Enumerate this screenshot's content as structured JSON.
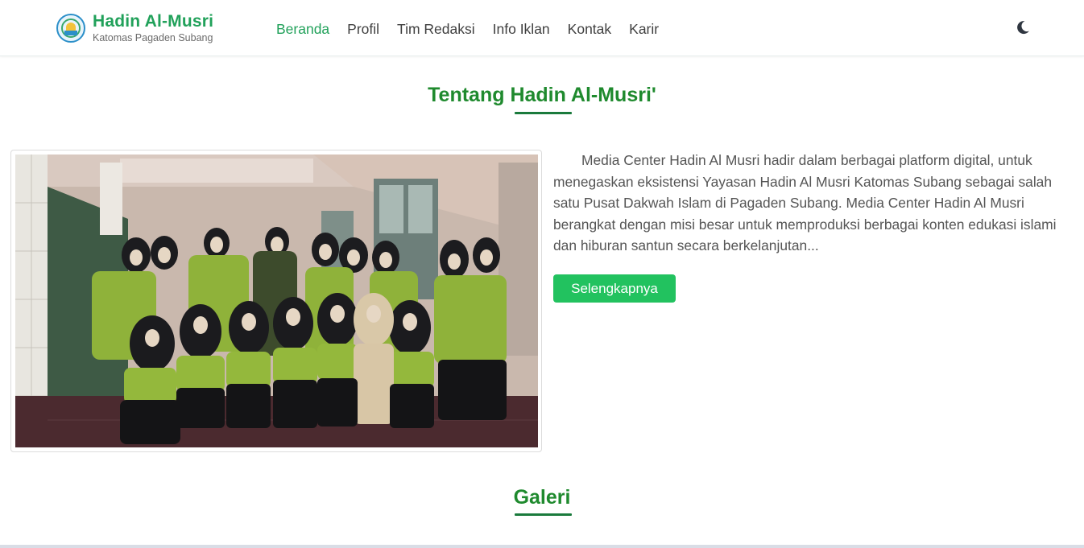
{
  "header": {
    "brand_title": "Hadin Al-Musri",
    "brand_subtitle": "Katomas Pagaden Subang",
    "logo_icon": "mosque-logo-icon",
    "nav": [
      "Beranda",
      "Profil",
      "Tim Redaksi",
      "Info Iklan",
      "Kontak",
      "Karir"
    ],
    "active_nav": "Beranda",
    "theme_icon": "moon-icon"
  },
  "about": {
    "title": "Tentang Hadin Al-Musri'",
    "text": "Media Center Hadin Al Musri hadir dalam berbagai platform digital, untuk menegaskan eksistensi Yayasan Hadin Al Musri Katomas Subang sebagai salah satu Pusat Dakwah Islam di Pagaden Subang. Media Center Hadin Al Musri berangkat dengan misi besar untuk memproduksi berbagai konten edukasi islami dan hiburan santun secara berkelanjutan...",
    "button": "Selengkapnya"
  },
  "gallery": {
    "title": "Galeri"
  },
  "colors": {
    "brand_green": "#21a15a",
    "title_green": "#1f8a2e",
    "button_green": "#22c25f",
    "uniform_green": "#8fb23a"
  }
}
